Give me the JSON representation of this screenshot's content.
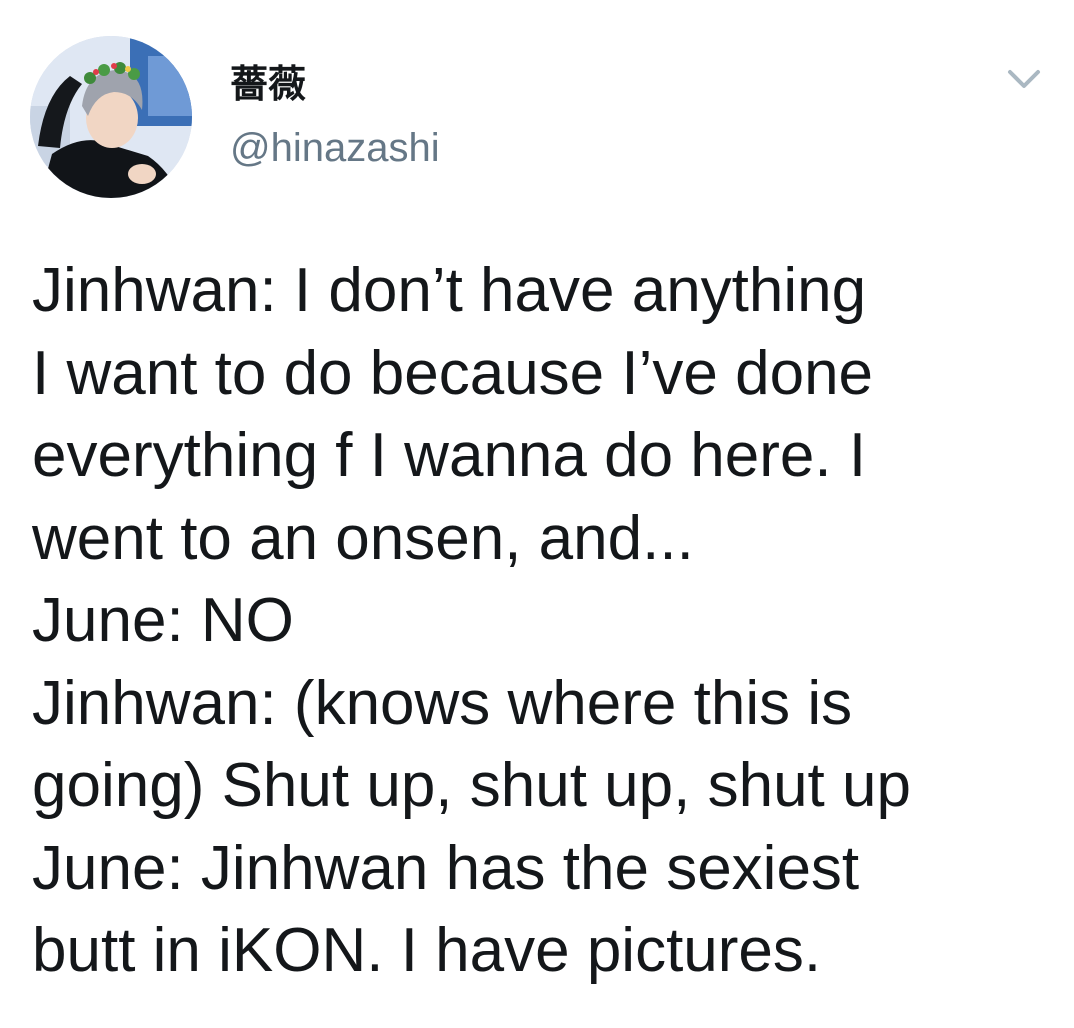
{
  "user": {
    "display_name": "薔薇",
    "handle": "@hinazashi",
    "avatar_icon": "profile-avatar"
  },
  "menu": {
    "icon": "chevron-down-icon"
  },
  "tweet": {
    "lines": [
      "Jinhwan: I don’t have anything",
      "I want to do because I’ve done",
      "everything f I wanna do here. I",
      "went to an onsen, and...",
      "June: NO",
      "Jinhwan: (knows where this is",
      "going) Shut up, shut up, shut up",
      "June: Jinhwan has the sexiest",
      "butt in iKON. I have pictures."
    ]
  },
  "colors": {
    "text": "#14171a",
    "secondary": "#657786",
    "caret": "#aab8c2",
    "background": "#ffffff"
  }
}
